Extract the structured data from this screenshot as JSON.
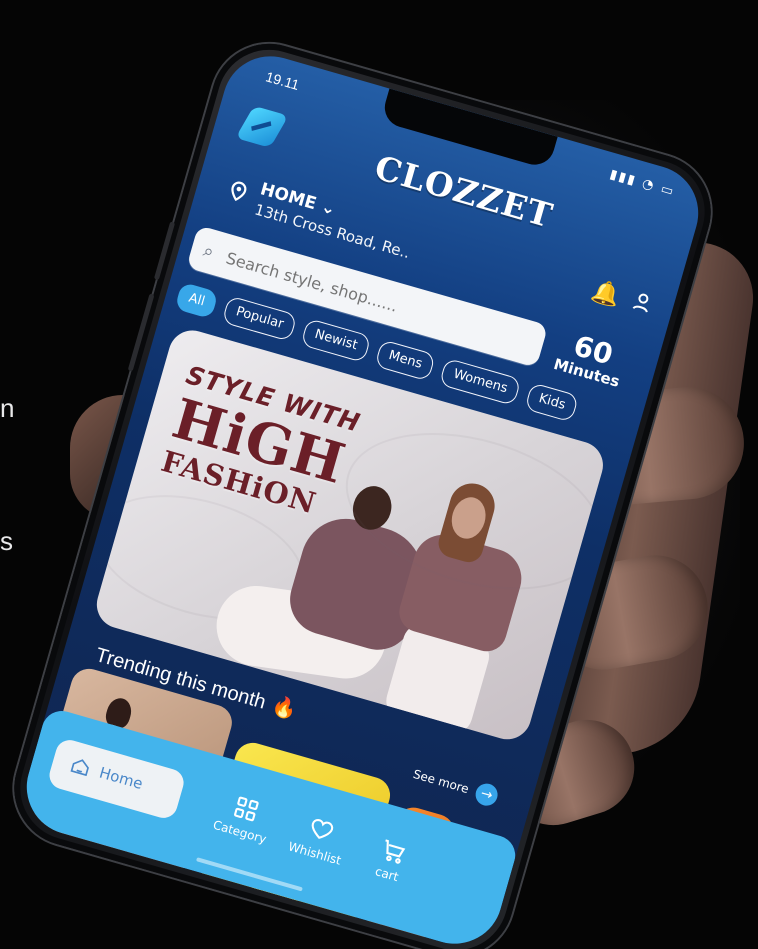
{
  "app": {
    "status_time": "19.11",
    "brand": "CLOZZET",
    "background_fragments": [
      "n",
      "s"
    ]
  },
  "header": {
    "location_title": "HOME",
    "location_subtitle": "13th Cross Road, Re.."
  },
  "search": {
    "placeholder": "Search style, shop......",
    "eta_value": "60",
    "eta_label": "Minutes"
  },
  "filters": [
    {
      "label": "All",
      "active": true
    },
    {
      "label": "Popular",
      "active": false
    },
    {
      "label": "Newist",
      "active": false
    },
    {
      "label": "Mens",
      "active": false
    },
    {
      "label": "Womens",
      "active": false
    },
    {
      "label": "Kids",
      "active": false
    }
  ],
  "hero": {
    "line1": "STYLE WITH",
    "line2": "HiGH",
    "line3": "FASHiON"
  },
  "trending": {
    "title": "Trending this month",
    "see_more": "See more"
  },
  "bottom_nav": {
    "home": "Home",
    "category": "Category",
    "wishlist": "Whishlist",
    "cart": "cart"
  },
  "colors": {
    "accent": "#38a7e9",
    "nav": "#43b4ec",
    "screen_top": "#245ea6",
    "screen_bottom": "#10254f"
  }
}
